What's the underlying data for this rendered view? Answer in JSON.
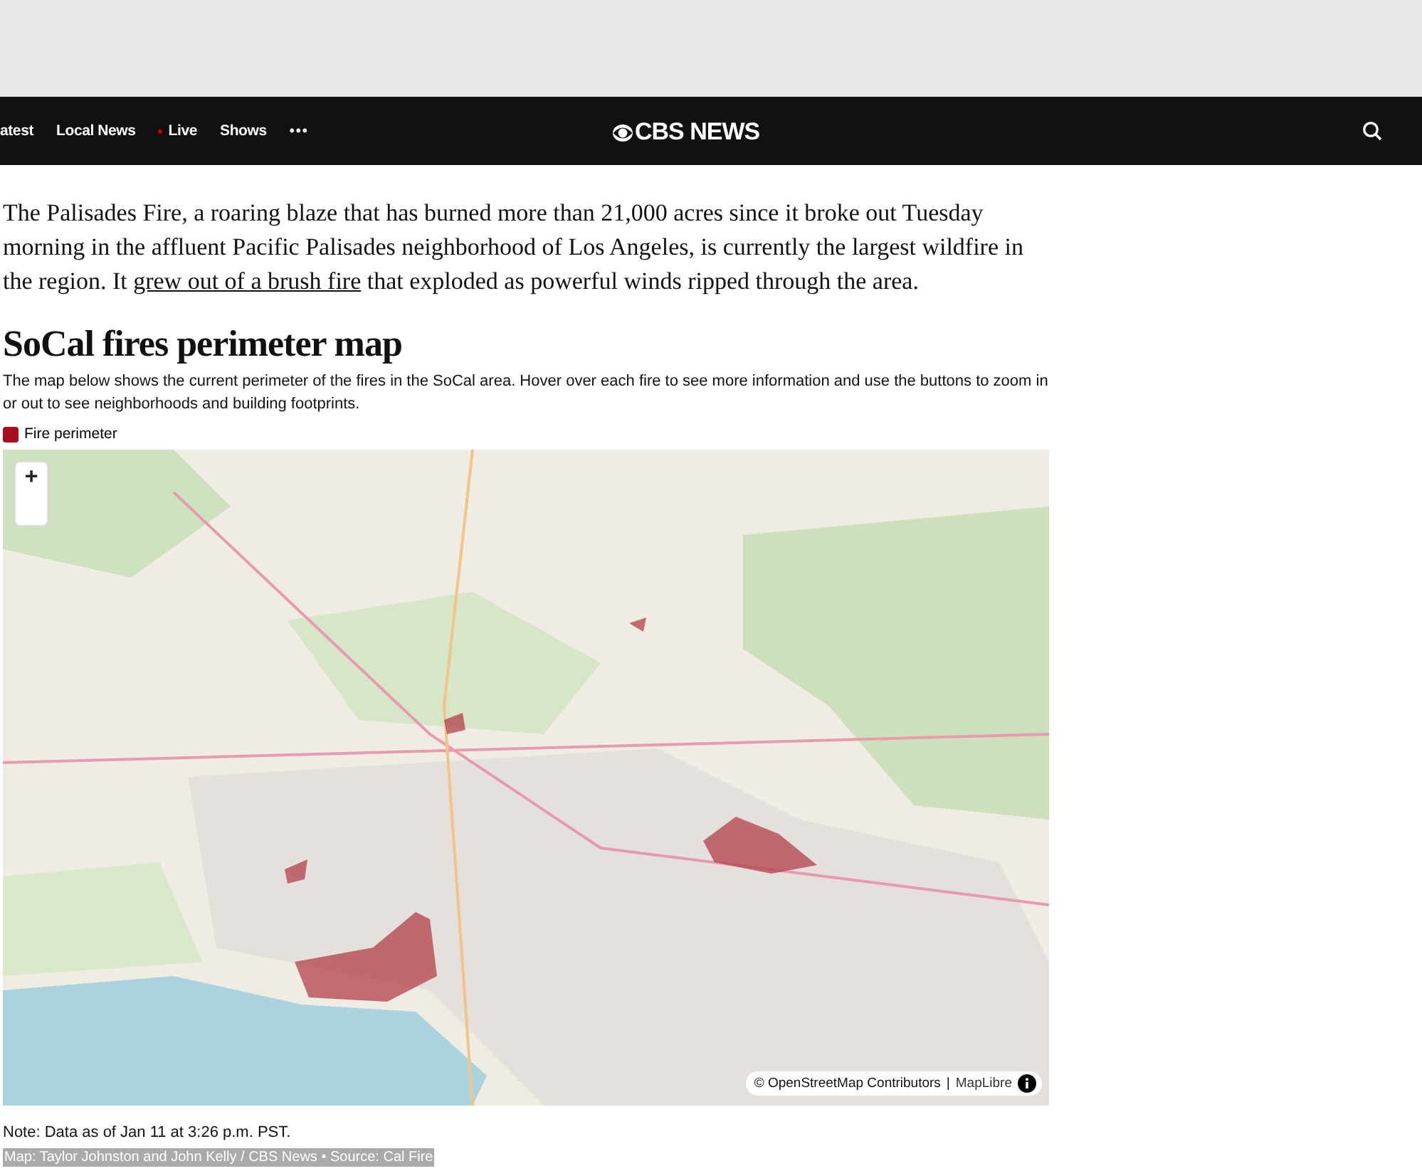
{
  "nav": {
    "items": [
      {
        "label": "atest",
        "kind": "text"
      },
      {
        "label": "Local News",
        "kind": "text"
      },
      {
        "label": "Live",
        "kind": "live"
      },
      {
        "label": "Shows",
        "kind": "text"
      },
      {
        "label": "•••",
        "kind": "more"
      }
    ],
    "logo": "CBS NEWS"
  },
  "intro": {
    "before": "The Palisades Fire, a roaring blaze that has burned more than 21,000 acres since it broke out Tuesday morning in the affluent Pacific Palisades neighborhood of Los Angeles, is currently the largest wildfire in the region. It ",
    "link": "grew out of a brush fire",
    "after": " that exploded as powerful winds ripped through the area."
  },
  "heading": "SoCal fires perimeter map",
  "description": "The map below shows the current perimeter of the fires in the SoCal area. Hover over each fire to see more information and use the buttons to zoom in or out to see neighborhoods and building footprints.",
  "legend": {
    "label": "Fire perimeter"
  },
  "map": {
    "zoom_in": "+",
    "attribution": "© OpenStreetMap Contributors",
    "separator": "|",
    "maplibre": "MapLibre"
  },
  "note": "Note: Data as of Jan 11 at 3:26 p.m. PST.",
  "credit": "Map: Taylor Johnston and John Kelly / CBS News • Source: Cal Fire"
}
